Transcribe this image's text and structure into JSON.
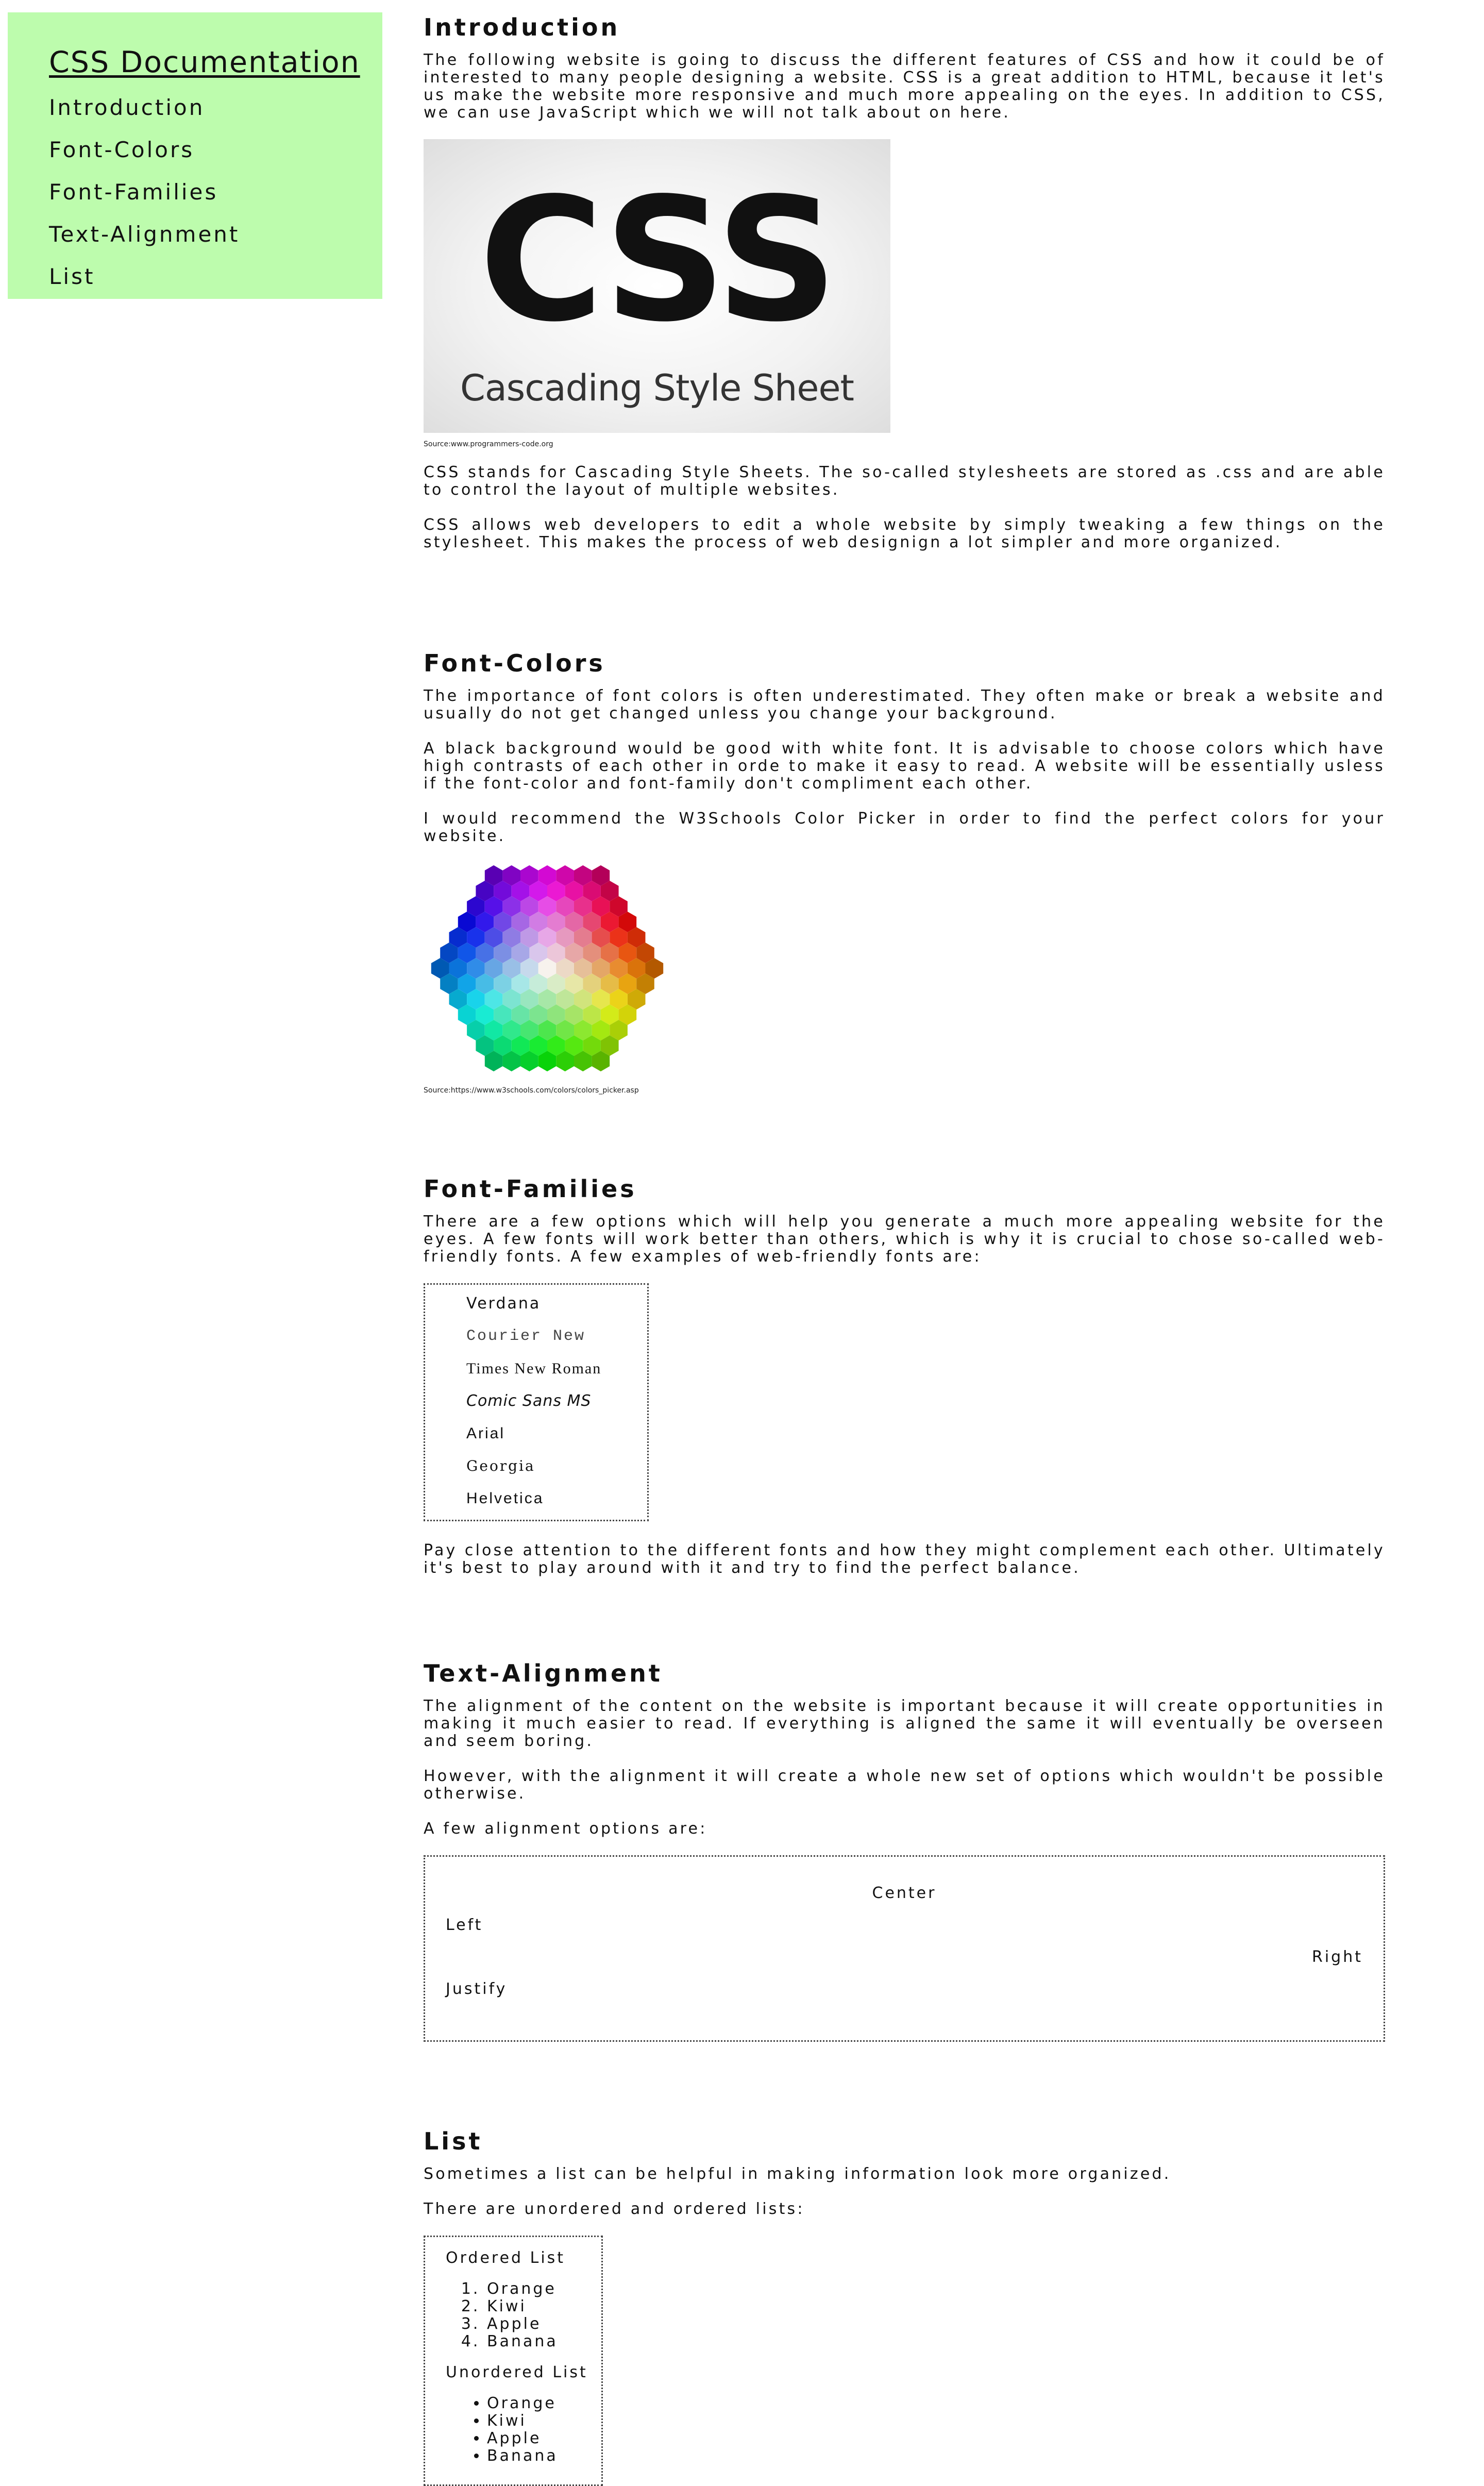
{
  "sidebar": {
    "title": "CSS Documentation",
    "links": [
      "Introduction",
      "Font-Colors",
      "Font-Families",
      "Text-Alignment",
      "List"
    ],
    "background": "#bdfcad"
  },
  "introduction": {
    "heading": "Introduction",
    "p1": "The following website is going to discuss the different features of CSS and how it could be of interested to many people designing a website. CSS is a great addition to HTML, because it let's us make the website more responsive and much more appealing on the eyes. In addition to CSS, we can use JavaScript which we will not talk about on here.",
    "logo_big": "CSS",
    "logo_sub": "Cascading Style Sheet",
    "caption": "Source:www.programmers-code.org",
    "p2": "CSS stands for Cascading Style Sheets. The so-called stylesheets are stored as .css and are able to control the layout of multiple websites.",
    "p3": "CSS allows web developers to edit a whole website by simply tweaking a few things on the stylesheet. This makes the process of web designign a lot simpler and more organized."
  },
  "font_colors": {
    "heading": "Font-Colors",
    "p1": "The importance of font colors is often underestimated. They often make or break a website and usually do not get changed unless you change your background.",
    "p2": "A black background would be good with white font. It is advisable to choose colors which have high contrasts of each other in orde to make it easy to read. A website will be essentially usless if the font-color and font-family don't compliment each other.",
    "p3": "I would recommend the W3Schools Color Picker in order to find the perfect colors for your website.",
    "caption": "Source:https://www.w3schools.com/colors/colors_picker.asp"
  },
  "font_families": {
    "heading": "Font-Families",
    "p1": "There are a few options which will help you generate a much more appealing website for the eyes. A few fonts will work better than others, which is why it is crucial to chose so-called web-friendly fonts. A few examples of web-friendly fonts are:",
    "fonts": [
      "Verdana",
      "Courier New",
      "Times New Roman",
      "Comic Sans MS",
      "Arial",
      "Georgia",
      "Helvetica"
    ],
    "p2": "Pay close attention to the different fonts and how they might complement each other. Ultimately it's best to play around with it and try to find the perfect balance."
  },
  "text_alignment": {
    "heading": "Text-Alignment",
    "p1": "The alignment of the content on the website is important because it will create opportunities in making it much easier to read. If everything is aligned the same it will eventually be overseen and seem boring.",
    "p2": "However, with the alignment it will create a whole new set of options which wouldn't be possible otherwise.",
    "p3": "A few alignment options are:",
    "options": [
      "Center",
      "Left",
      "Right",
      "Justify"
    ]
  },
  "list": {
    "heading": "List",
    "p1": "Sometimes a list can be helpful in making information look more organized.",
    "p2": "There are unordered and ordered lists:",
    "ordered_heading": "Ordered List",
    "ordered": [
      "Orange",
      "Kiwi",
      "Apple",
      "Banana"
    ],
    "unordered_heading": "Unordered List",
    "unordered": [
      "Orange",
      "Kiwi",
      "Apple",
      "Banana"
    ]
  }
}
